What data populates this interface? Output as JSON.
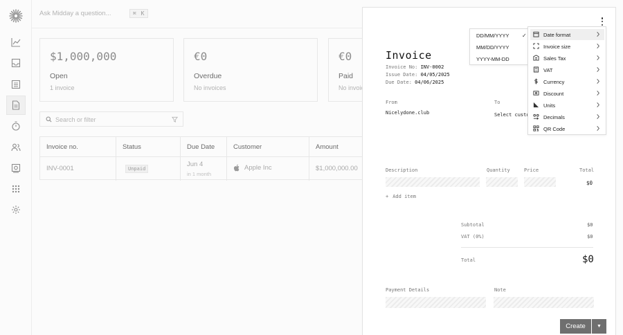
{
  "topbar": {
    "ask_placeholder": "Ask Midday a question...",
    "shortcut": "⌘ K"
  },
  "cards": [
    {
      "amount": "$1,000,000",
      "label": "Open",
      "sub": "1 invoice"
    },
    {
      "amount": "€0",
      "label": "Overdue",
      "sub": "No invoices"
    },
    {
      "amount": "€0",
      "label": "Paid",
      "sub": "No invoic"
    }
  ],
  "search": {
    "placeholder": "Search or filter"
  },
  "table": {
    "headers": [
      "Invoice no.",
      "Status",
      "Due Date",
      "Customer",
      "Amount"
    ],
    "row": {
      "invoice_no": "INV-0001",
      "status": "Unpaid",
      "due_date": "Jun 4",
      "due_relative": "in 1 month",
      "customer": "Apple Inc",
      "amount": "$1,000,000.00"
    }
  },
  "invoice": {
    "title": "Invoice",
    "invoice_no_label": "Invoice No:",
    "invoice_no": "INV-0002",
    "issue_date_label": "Issue Date:",
    "issue_date": "04/05/2025",
    "due_date_label": "Due Date:",
    "due_date": "04/06/2025",
    "from_label": "From",
    "from_value": "Nicelydone.club",
    "to_label": "To",
    "to_value": "Select custo",
    "description_label": "Description",
    "quantity_label": "Quantity",
    "price_label": "Price",
    "total_label": "Total",
    "line_total": "$0",
    "add_item": "Add item",
    "subtotal_label": "Subtotal",
    "subtotal_value": "$0",
    "vat_label": "VAT (0%)",
    "vat_value": "$0",
    "grand_total_label": "Total",
    "grand_total_value": "$0",
    "payment_details_label": "Payment Details",
    "note_label": "Note"
  },
  "actions": {
    "create": "Create"
  },
  "date_format_menu": {
    "options": [
      "DD/MM/YYYY",
      "MM/DD/YYYY",
      "YYYY-MM-DD"
    ],
    "selected": "DD/MM/YYYY"
  },
  "settings_menu": {
    "items": [
      {
        "label": "Date format",
        "icon": "calendar-icon"
      },
      {
        "label": "Invoice size",
        "icon": "expand-icon"
      },
      {
        "label": "Sales Tax",
        "icon": "building-icon"
      },
      {
        "label": "VAT",
        "icon": "calculator-icon"
      },
      {
        "label": "Currency",
        "icon": "dollar-icon"
      },
      {
        "label": "Discount",
        "icon": "ticket-icon"
      },
      {
        "label": "Units",
        "icon": "ruler-icon"
      },
      {
        "label": "Decimals",
        "icon": "decimal-icon"
      },
      {
        "label": "QR Code",
        "icon": "qr-code-icon"
      }
    ]
  }
}
